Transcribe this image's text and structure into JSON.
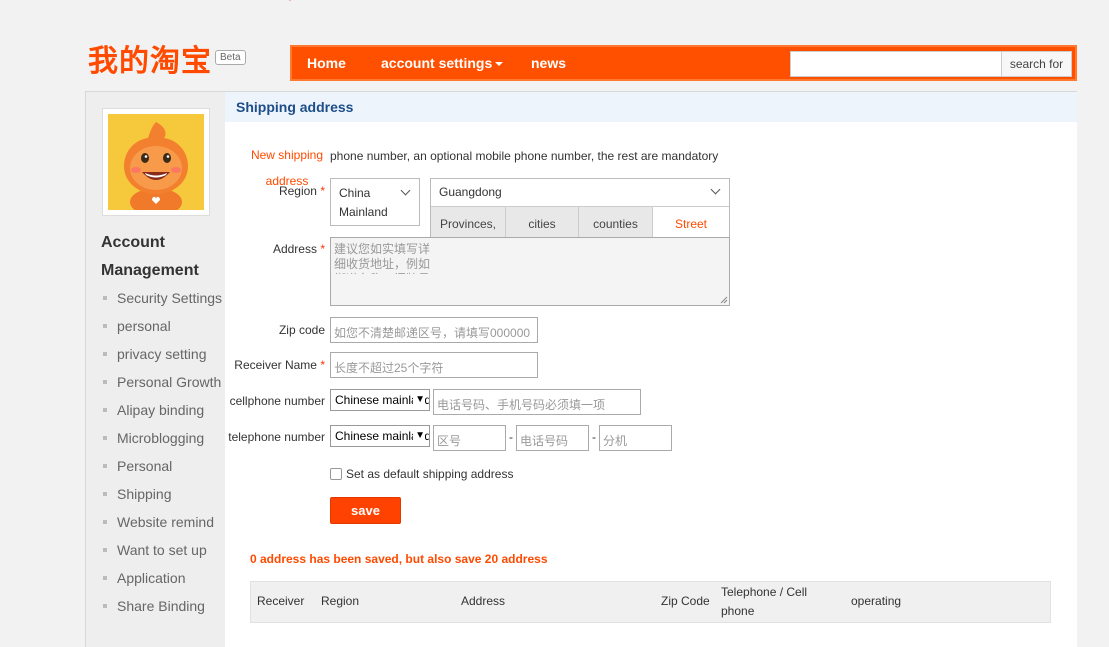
{
  "header": {
    "logo_text": "我的淘宝",
    "beta_badge": "Beta",
    "nav": {
      "home": "Home",
      "account_settings": "account settings",
      "news": "news"
    },
    "search": {
      "value": "",
      "button_label": "search for"
    }
  },
  "sidebar": {
    "title": "Account Management",
    "items": [
      "Security Settings",
      "personal",
      "privacy setting",
      "Personal Growth",
      "Alipay binding",
      "Microblogging",
      "Personal",
      "Shipping",
      "Website remind",
      "Want to set up",
      "Application",
      "Share Binding"
    ]
  },
  "panel": {
    "title": "Shipping address",
    "form": {
      "new_address": "New shipping address",
      "hint": "phone number, an optional mobile phone number, the rest are mandatory",
      "required_mark": "*",
      "region_label": "Region",
      "country_value": "China Mainland",
      "province_value": "Guangdong",
      "region_tabs": [
        "Provinces,",
        "cities",
        "counties",
        "Street"
      ],
      "address_label": "Address",
      "address_placeholder": "建议您如实填写详细收货地址，例如街道名称，门牌号码，楼层和房间号等信息",
      "zip_label": "Zip code",
      "zip_placeholder": "如您不清楚邮递区号，请填写000000",
      "receiver_label": "Receiver Name",
      "receiver_placeholder": "长度不超过25个字符",
      "cellphone_label": "cellphone number",
      "cellphone_country": "Chinese mainland",
      "cellphone_placeholder": "电话号码、手机号码必须填一项",
      "telephone_label": "telephone number",
      "telephone_country": "Chinese mainland",
      "area_placeholder": "区号",
      "phone_placeholder": "电话号码",
      "ext_placeholder": "分机",
      "dash": "-",
      "default_label": "Set as default shipping address",
      "save_label": "save"
    },
    "notice": "0 address has been saved, but also save 20 address",
    "table_headers": [
      "Receiver",
      "Region",
      "Address",
      "Zip Code",
      "Telephone / Cell phone",
      "operating"
    ]
  }
}
